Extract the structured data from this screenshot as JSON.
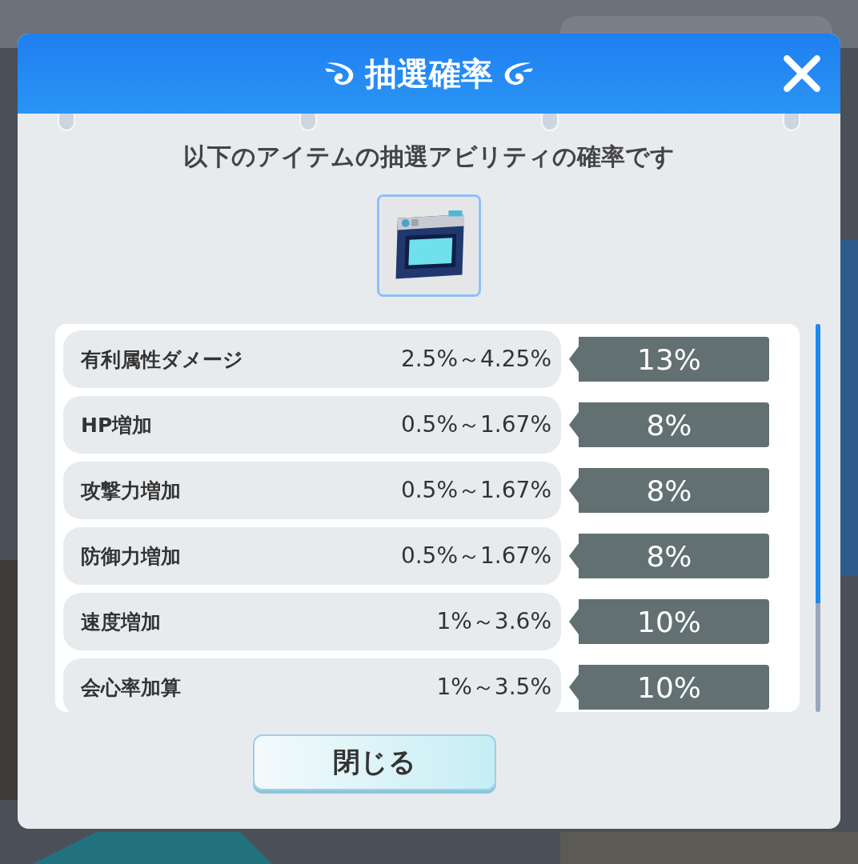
{
  "dialog": {
    "title": "抽選確率",
    "subtitle": "以下のアイテムの抽選アビリティの確率です",
    "rows": [
      {
        "name": "有利属性ダメージ",
        "range": "2.5%～4.25%",
        "rate": "13%"
      },
      {
        "name": "HP増加",
        "range": "0.5%～1.67%",
        "rate": "8%"
      },
      {
        "name": "攻撃力増加",
        "range": "0.5%～1.67%",
        "rate": "8%"
      },
      {
        "name": "防御力増加",
        "range": "0.5%～1.67%",
        "rate": "8%"
      },
      {
        "name": "速度増加",
        "range": "1%～3.6%",
        "rate": "10%"
      },
      {
        "name": "会心率加算",
        "range": "1%～3.5%",
        "rate": "10%"
      }
    ],
    "close_button": "閉じる"
  }
}
